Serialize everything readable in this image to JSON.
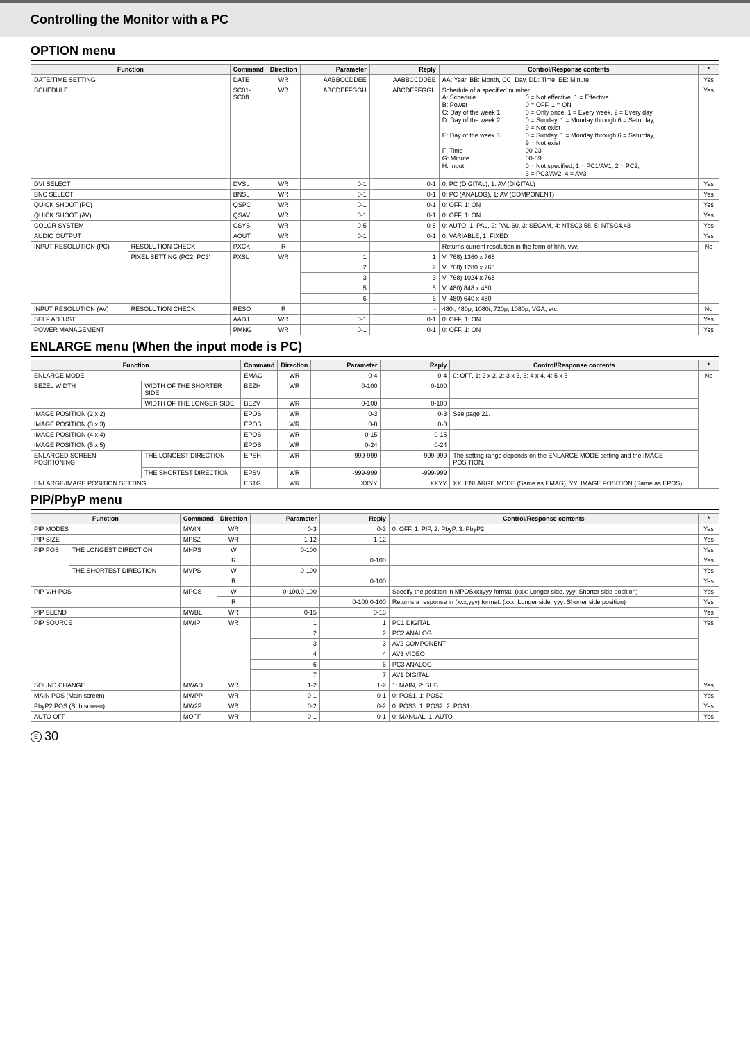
{
  "header": {
    "title": "Controlling the Monitor with a PC"
  },
  "section1": {
    "title": "OPTION menu",
    "headers": [
      "Function",
      "Command",
      "Direction",
      "Parameter",
      "Reply",
      "Control/Response contents",
      "*"
    ],
    "rows": [
      {
        "fn": "DATE/TIME SETTING",
        "fn2": "",
        "cmd": "DATE",
        "dir": "WR",
        "param": "AABBCCDDEE",
        "reply": "AABBCCDDEE",
        "ctrl": "AA: Year, BB: Month, CC: Day, DD: Time, EE: Minute",
        "star": "Yes",
        "fnspan": 2
      },
      {
        "fn": "SCHEDULE",
        "fn2": "",
        "cmd": "SC01-SC08",
        "dir": "WR",
        "param": "ABCDEFFGGH",
        "reply": "ABCDEFFGGH",
        "ctrl": "SCHED",
        "star": "Yes",
        "fnspan": 2
      },
      {
        "fn": "DVI SELECT",
        "fn2": "",
        "cmd": "DVSL",
        "dir": "WR",
        "param": "0-1",
        "reply": "0-1",
        "ctrl": "0: PC (DIGITAL), 1: AV (DIGITAL)",
        "star": "Yes",
        "fnspan": 2
      },
      {
        "fn": "BNC SELECT",
        "fn2": "",
        "cmd": "BNSL",
        "dir": "WR",
        "param": "0-1",
        "reply": "0-1",
        "ctrl": "0: PC (ANALOG), 1: AV (COMPONENT)",
        "star": "Yes",
        "fnspan": 2
      },
      {
        "fn": "QUICK SHOOT (PC)",
        "fn2": "",
        "cmd": "QSPC",
        "dir": "WR",
        "param": "0-1",
        "reply": "0-1",
        "ctrl": "0: OFF, 1: ON",
        "star": "Yes",
        "fnspan": 2
      },
      {
        "fn": "QUICK SHOOT (AV)",
        "fn2": "",
        "cmd": "QSAV",
        "dir": "WR",
        "param": "0-1",
        "reply": "0-1",
        "ctrl": "0: OFF, 1: ON",
        "star": "Yes",
        "fnspan": 2
      },
      {
        "fn": "COLOR SYSTEM",
        "fn2": "",
        "cmd": "CSYS",
        "dir": "WR",
        "param": "0-5",
        "reply": "0-5",
        "ctrl": "0: AUTO, 1: PAL, 2: PAL-60, 3: SECAM, 4: NTSC3.58, 5: NTSC4.43",
        "star": "Yes",
        "fnspan": 2
      },
      {
        "fn": "AUDIO OUTPUT",
        "fn2": "",
        "cmd": "AOUT",
        "dir": "WR",
        "param": "0-1",
        "reply": "0-1",
        "ctrl": "0: VARIABLE, 1: FIXED",
        "star": "Yes",
        "fnspan": 2
      }
    ],
    "input_res": {
      "fn": "INPUT RESOLUTION (PC)",
      "sub1": "RESOLUTION CHECK",
      "cmd1": "PXCK",
      "dir1": "R",
      "param1": "",
      "reply1": "-",
      "ctrl1": "Returns current resolution in the form of hhh, vvv.",
      "sub2": "PIXEL SETTING (PC2, PC3)",
      "cmd2": "PXSL",
      "dir2": "WR",
      "pix": [
        {
          "param": "1",
          "reply": "1",
          "ctrl": "V: 768) 1360 x 768"
        },
        {
          "param": "2",
          "reply": "2",
          "ctrl": "V: 768) 1280 x 768"
        },
        {
          "param": "3",
          "reply": "3",
          "ctrl": "V: 768) 1024 x 768"
        },
        {
          "param": "5",
          "reply": "5",
          "ctrl": "V: 480) 848 x 480"
        },
        {
          "param": "6",
          "reply": "6",
          "ctrl": "V: 480) 640 x 480"
        }
      ],
      "star": "No"
    },
    "input_res_av": {
      "fn": "INPUT RESOLUTION (AV)",
      "sub": "RESOLUTION CHECK",
      "cmd": "RESO",
      "dir": "R",
      "param": "",
      "reply": "-",
      "ctrl": "480i, 480p, 1080i, 720p, 1080p, VGA, etc.",
      "star": "No"
    },
    "tail": [
      {
        "fn": "SELF ADJUST",
        "cmd": "AADJ",
        "dir": "WR",
        "param": "0-1",
        "reply": "0-1",
        "ctrl": "0: OFF, 1: ON",
        "star": "Yes"
      },
      {
        "fn": "POWER MANAGEMENT",
        "cmd": "PMNG",
        "dir": "WR",
        "param": "0-1",
        "reply": "0-1",
        "ctrl": "0: OFF, 1: ON",
        "star": "Yes"
      }
    ],
    "sched": {
      "lead": "Schedule of a specified number",
      "rows": [
        {
          "l": "A: Schedule",
          "r": "0 = Not effective, 1 = Effective"
        },
        {
          "l": "B: Power",
          "r": "0 = OFF, 1 = ON"
        },
        {
          "l": "C: Day of the week 1",
          "r": "0 = Only once, 1 = Every week, 2 = Every day"
        },
        {
          "l": "D: Day of the week 2",
          "r": "0 = Sunday, 1 = Monday through 6 = Saturday,"
        },
        {
          "l": "",
          "r": "9 = Not exist"
        },
        {
          "l": "E: Day of the week 3",
          "r": "0 = Sunday, 1 = Monday through 6 = Saturday,"
        },
        {
          "l": "",
          "r": "9 = Not exist"
        },
        {
          "l": "F: Time",
          "r": "00-23"
        },
        {
          "l": "G: Minute",
          "r": "00-59"
        },
        {
          "l": "H: Input",
          "r": "0 = Not specified, 1 = PC1/AV1, 2 = PC2,"
        },
        {
          "l": "",
          "r": "3 = PC3/AV2, 4 = AV3"
        }
      ]
    }
  },
  "section2": {
    "title": "ENLARGE menu (When the input mode is PC)",
    "headers": [
      "Function",
      "Command",
      "Direction",
      "Parameter",
      "Reply",
      "Control/Response contents",
      "*"
    ],
    "rows": [
      {
        "fn": "ENLARGE MODE",
        "sub": "",
        "cmd": "EMAG",
        "dir": "WR",
        "param": "0-4",
        "reply": "0-4",
        "ctrl": "0: OFF, 1: 2 x 2, 2: 3 x 3, 3: 4 x 4, 4: 5 x 5",
        "fnspan": 2
      },
      {
        "fn": "BEZEL WIDTH",
        "sub": "WIDTH OF THE SHORTER SIDE",
        "cmd": "BEZH",
        "dir": "WR",
        "param": "0-100",
        "reply": "0-100",
        "ctrl": ""
      },
      {
        "fn": "",
        "sub": "WIDTH OF THE LONGER SIDE",
        "cmd": "BEZV",
        "dir": "WR",
        "param": "0-100",
        "reply": "0-100",
        "ctrl": ""
      },
      {
        "fn": "IMAGE POSITION (2 x 2)",
        "sub": "",
        "cmd": "EPOS",
        "dir": "WR",
        "param": "0-3",
        "reply": "0-3",
        "ctrl": "See page 21.",
        "fnspan": 2
      },
      {
        "fn": "IMAGE POSITION (3 x 3)",
        "sub": "",
        "cmd": "EPOS",
        "dir": "WR",
        "param": "0-8",
        "reply": "0-8",
        "ctrl": "",
        "fnspan": 2
      },
      {
        "fn": "IMAGE POSITION (4 x 4)",
        "sub": "",
        "cmd": "EPOS",
        "dir": "WR",
        "param": "0-15",
        "reply": "0-15",
        "ctrl": "",
        "fnspan": 2
      },
      {
        "fn": "IMAGE POSITION (5 x 5)",
        "sub": "",
        "cmd": "EPOS",
        "dir": "WR",
        "param": "0-24",
        "reply": "0-24",
        "ctrl": "",
        "fnspan": 2
      },
      {
        "fn": "ENLARGED SCREEN POSITIONING",
        "sub": "THE LONGEST DIRECTION",
        "cmd": "EPSH",
        "dir": "WR",
        "param": "-999-999",
        "reply": "-999-999",
        "ctrl": "The setting range depends on the ENLARGE MODE setting and the IMAGE POSITION."
      },
      {
        "fn": "",
        "sub": "THE SHORTEST DIRECTION",
        "cmd": "EPSV",
        "dir": "WR",
        "param": "-999-999",
        "reply": "-999-999",
        "ctrl": ""
      },
      {
        "fn": "ENLARGE/IMAGE POSITION SETTING",
        "sub": "",
        "cmd": "ESTG",
        "dir": "WR",
        "param": "XXYY",
        "reply": "XXYY",
        "ctrl": "XX: ENLARGE MODE (Same as EMAG), YY: IMAGE POSITION (Same as EPOS)",
        "fnspan": 2
      }
    ],
    "star": "No"
  },
  "section3": {
    "title": "PIP/PbyP menu",
    "headers": [
      "Function",
      "Command",
      "Direction",
      "Parameter",
      "Reply",
      "Control/Response contents",
      "*"
    ],
    "rows": [
      {
        "fn": "PIP MODES",
        "sub": "",
        "cmd": "MWIN",
        "dir": "WR",
        "param": "0-3",
        "reply": "0-3",
        "ctrl": "0: OFF, 1: PIP, 2: PbyP, 3: PbyP2",
        "star": "Yes",
        "fnspan": 2
      },
      {
        "fn": "PIP SIZE",
        "sub": "",
        "cmd": "MPSZ",
        "dir": "WR",
        "param": "1-12",
        "reply": "1-12",
        "ctrl": "",
        "star": "Yes",
        "fnspan": 2
      },
      {
        "fn": "PIP POS",
        "sub": "THE LONGEST DIRECTION",
        "cmd": "MHPS",
        "dir": "W",
        "param": "0-100",
        "reply": "",
        "ctrl": "",
        "star": "Yes"
      },
      {
        "fn": "",
        "sub": "",
        "cmd": "",
        "dir": "R",
        "param": "",
        "reply": "0-100",
        "ctrl": "",
        "star": "Yes"
      },
      {
        "fn": "",
        "sub": "THE SHORTEST DIRECTION",
        "cmd": "MVPS",
        "dir": "W",
        "param": "0-100",
        "reply": "",
        "ctrl": "",
        "star": "Yes"
      },
      {
        "fn": "",
        "sub": "",
        "cmd": "",
        "dir": "R",
        "param": "",
        "reply": "0-100",
        "ctrl": "",
        "star": "Yes"
      },
      {
        "fn": "PIP V/H-POS",
        "sub": "",
        "cmd": "MPOS",
        "dir": "W",
        "param": "0-100,0-100",
        "reply": "",
        "ctrl": "Specify the position in MPOSxxxyyy format. (xxx: Longer side, yyy: Shorter side position)",
        "star": "Yes",
        "fnspan": 2
      },
      {
        "fn": "",
        "sub": "",
        "cmd": "",
        "dir": "R",
        "param": "",
        "reply": "0-100,0-100",
        "ctrl": "Returns a response in (xxx,yyy) format. (xxx: Longer side, yyy: Shorter side position)",
        "star": "Yes",
        "fnspan": 2
      },
      {
        "fn": "PIP BLEND",
        "sub": "",
        "cmd": "MWBL",
        "dir": "WR",
        "param": "0-15",
        "reply": "0-15",
        "ctrl": "",
        "star": "Yes",
        "fnspan": 2
      }
    ],
    "pipsource": {
      "fn": "PIP SOURCE",
      "cmd": "MWIP",
      "dir": "WR",
      "items": [
        {
          "param": "1",
          "reply": "1",
          "ctrl": "PC1 DIGITAL"
        },
        {
          "param": "2",
          "reply": "2",
          "ctrl": "PC2 ANALOG"
        },
        {
          "param": "3",
          "reply": "3",
          "ctrl": "AV2 COMPONENT"
        },
        {
          "param": "4",
          "reply": "4",
          "ctrl": "AV3 VIDEO"
        },
        {
          "param": "6",
          "reply": "6",
          "ctrl": "PC3 ANALOG"
        },
        {
          "param": "7",
          "reply": "7",
          "ctrl": "AV1 DIGITAL"
        }
      ],
      "star": "Yes"
    },
    "tail": [
      {
        "fn": "SOUND CHANGE",
        "cmd": "MWAD",
        "dir": "WR",
        "param": "1-2",
        "reply": "1-2",
        "ctrl": "1: MAIN, 2: SUB",
        "star": "Yes"
      },
      {
        "fn": "MAIN POS (Main screen)",
        "cmd": "MWPP",
        "dir": "WR",
        "param": "0-1",
        "reply": "0-1",
        "ctrl": "0: POS1, 1: POS2",
        "star": "Yes"
      },
      {
        "fn": "PbyP2 POS (Sub screen)",
        "cmd": "MW2P",
        "dir": "WR",
        "param": "0-2",
        "reply": "0-2",
        "ctrl": "0: POS3, 1: POS2, 2: POS1",
        "star": "Yes"
      },
      {
        "fn": "AUTO OFF",
        "cmd": "MOFF",
        "dir": "WR",
        "param": "0-1",
        "reply": "0-1",
        "ctrl": "0: MANUAL, 1: AUTO",
        "star": "Yes"
      }
    ]
  },
  "footer": {
    "e": "E",
    "page": "30"
  }
}
